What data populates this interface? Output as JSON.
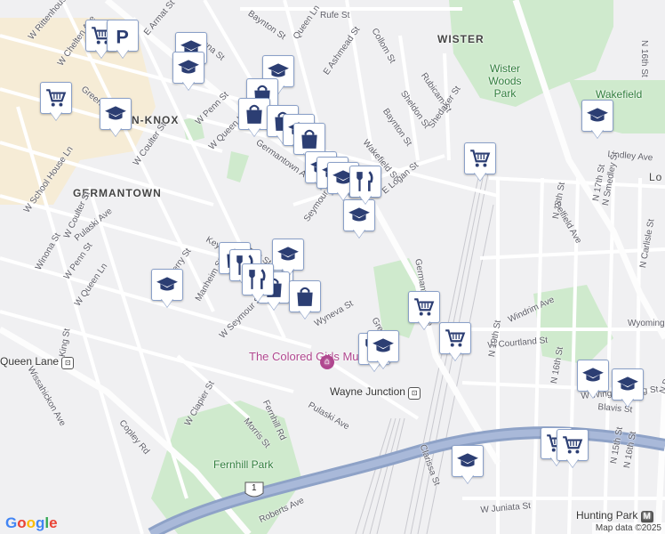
{
  "map": {
    "attribution": "Map data ©2025",
    "logo_text": "Google",
    "neighborhoods": [
      {
        "name": "WISTER"
      },
      {
        "name": "GERMANTOWN"
      },
      {
        "name": "N-KNOX"
      },
      {
        "name": "Lo"
      }
    ],
    "parks": [
      {
        "name": "Wister Woods Park"
      },
      {
        "name": "Fernhill Park"
      },
      {
        "name": "Wakefield"
      }
    ],
    "pois": [
      {
        "name": "The Colored Girls Museum",
        "icon": "museum-icon"
      }
    ],
    "stations": [
      {
        "name": "Wayne Junction",
        "icon": "rail-station-icon"
      },
      {
        "name": "Hunting Park",
        "icon": "subway-icon"
      },
      {
        "name": "Queen Lane",
        "icon": "rail-station-icon"
      }
    ],
    "route_shield": "1",
    "streets": [
      "W Rittenhouse St",
      "E Armat St",
      "Lena St",
      "Baynton St",
      "Rufe St",
      "Queen Ln",
      "E Ashmead St",
      "Collom St",
      "Rubicam St",
      "Sheldon St",
      "Baynton St",
      "Shedaker St",
      "Wakefield St",
      "Lindley Ave",
      "Greene St",
      "W Chelten Ave",
      "W Penn St",
      "W Queen Ln",
      "W Coulter St",
      "W School House Ln",
      "Germantown Ave",
      "E Logan St",
      "Seymour St",
      "Keyser St",
      "Knox St",
      "Pulaski Ave",
      "Winona St",
      "W Penn St",
      "W Queen Ln",
      "King St",
      "W Coulter St",
      "Hansberry St",
      "Manheim St",
      "W Seymour St",
      "Wyneva St",
      "Germantown Ave",
      "W Courtland St",
      "Windrim Ave",
      "N 19th St",
      "N 18th St",
      "N 17th St",
      "N Smedley St",
      "Belfield Ave",
      "N 16th St",
      "N Carlisle St",
      "Wyoming Ave",
      "N 16th St",
      "W Wingohocking St",
      "Blavis St",
      "N Broad St",
      "Wissahickon Ave",
      "Copley Rd",
      "W Clapier St",
      "Morris St",
      "Fernhill Rd",
      "Pulaski Ave",
      "Clarissa St",
      "W Juniata St",
      "N 15th St",
      "N 16th St",
      "Roberts Ave",
      "Greene St"
    ],
    "markers": [
      {
        "type": "shopping-cart-icon"
      },
      {
        "type": "parking-icon"
      },
      {
        "type": "school-icon"
      },
      {
        "type": "school-icon"
      },
      {
        "type": "school-icon"
      },
      {
        "type": "shopping-cart-icon"
      },
      {
        "type": "school-icon"
      },
      {
        "type": "shopping-bag-icon"
      },
      {
        "type": "shopping-bag-icon"
      },
      {
        "type": "shopping-bag-icon"
      },
      {
        "type": "school-icon"
      },
      {
        "type": "shopping-bag-icon"
      },
      {
        "type": "school-icon"
      },
      {
        "type": "school-icon"
      },
      {
        "type": "restaurant-icon"
      },
      {
        "type": "school-icon"
      },
      {
        "type": "school-icon"
      },
      {
        "type": "shopping-cart-icon"
      },
      {
        "type": "school-icon"
      },
      {
        "type": "restaurant-icon"
      },
      {
        "type": "restaurant-icon"
      },
      {
        "type": "school-icon"
      },
      {
        "type": "shopping-bag-icon"
      },
      {
        "type": "shopping-bag-icon"
      },
      {
        "type": "school-icon"
      },
      {
        "type": "shopping-bag-icon"
      },
      {
        "type": "restaurant-icon"
      },
      {
        "type": "restaurant-icon"
      },
      {
        "type": "restaurant-icon"
      },
      {
        "type": "school-icon"
      },
      {
        "type": "shopping-cart-icon"
      },
      {
        "type": "shopping-cart-icon"
      },
      {
        "type": "shopping-cart-icon"
      },
      {
        "type": "school-icon"
      },
      {
        "type": "shopping-cart-icon"
      },
      {
        "type": "school-icon"
      },
      {
        "type": "school-icon"
      }
    ]
  }
}
